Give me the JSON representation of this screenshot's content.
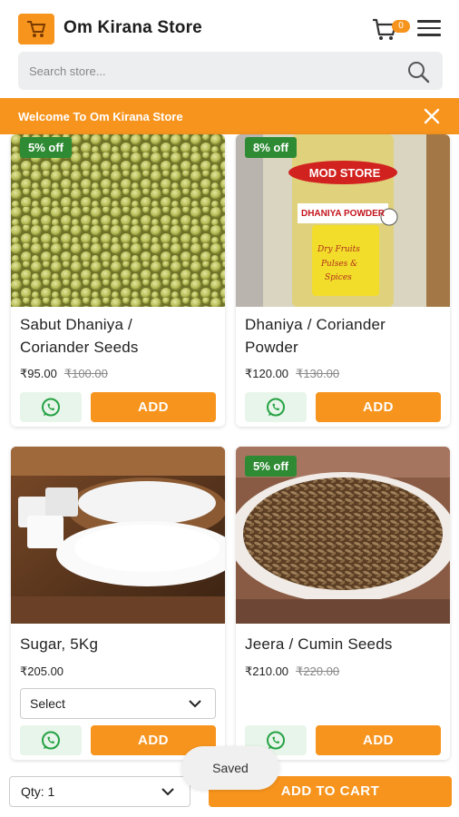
{
  "header": {
    "store_name": "Om Kirana Store",
    "cart_count": "0",
    "brand_color": "#f7941d"
  },
  "search": {
    "placeholder": "Search store..."
  },
  "banner": {
    "text": "Welcome To Om Kirana Store"
  },
  "products": [
    {
      "name_line1": "Sabut Dhaniya /",
      "name_line2": "Coriander Seeds",
      "price": "₹95.00",
      "mrp": "₹100.00",
      "discount": "5% off",
      "add_label": "ADD"
    },
    {
      "name_line1": "Dhaniya / Coriander",
      "name_line2": "Powder",
      "price": "₹120.00",
      "mrp": "₹130.00",
      "discount": "8% off",
      "add_label": "ADD",
      "package_brand": "MOD STORE",
      "package_label": "DHANIYA POWDER"
    },
    {
      "name_line1": "Sugar, 5Kg",
      "price": "₹205.00",
      "variant_select": "Select",
      "add_label": "ADD"
    },
    {
      "name_line1": "Jeera / Cumin Seeds",
      "price": "₹210.00",
      "mrp": "₹220.00",
      "discount": "5% off",
      "add_label": "ADD"
    }
  ],
  "bottom_bar": {
    "qty_label": "Qty: 1",
    "add_to_cart": "ADD TO CART"
  },
  "toast": "Saved",
  "icons": [
    "cart-icon",
    "menu-icon",
    "search-icon",
    "close-icon",
    "whatsapp-icon",
    "chevron-down-icon"
  ]
}
